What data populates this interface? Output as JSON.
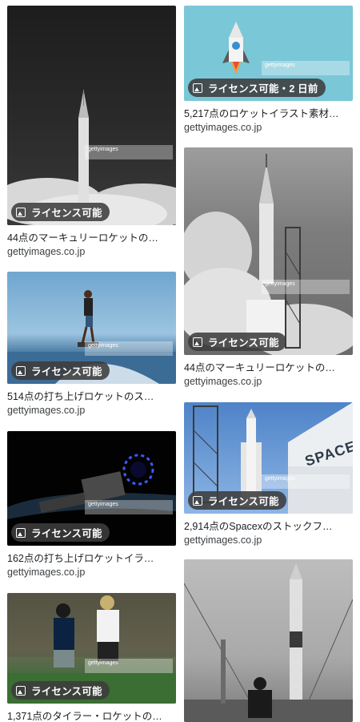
{
  "badge_label": "ライセンス可能",
  "badge_label_recent": "ライセンス可能・2 日前",
  "watermark": "gettyimages",
  "results": [
    {
      "title": "44点のマーキュリーロケットの…",
      "source": "gettyimages.co.jp"
    },
    {
      "title": "5,217点のロケットイラスト素材…",
      "source": "gettyimages.co.jp"
    },
    {
      "title": "514点の打ち上げロケットのス…",
      "source": "gettyimages.co.jp"
    },
    {
      "title": "44点のマーキュリーロケットの…",
      "source": "gettyimages.co.jp"
    },
    {
      "title": "162点の打ち上げロケットイラ…",
      "source": "gettyimages.co.jp"
    },
    {
      "title": "2,914点のSpacexのストックフ…",
      "source": "gettyimages.co.jp"
    },
    {
      "title": "1,371点のタイラー・ロケットの…",
      "source": ""
    },
    {
      "title": "",
      "source": ""
    }
  ],
  "spacex_sign": "SPACEX",
  "image_icon": "image-icon"
}
